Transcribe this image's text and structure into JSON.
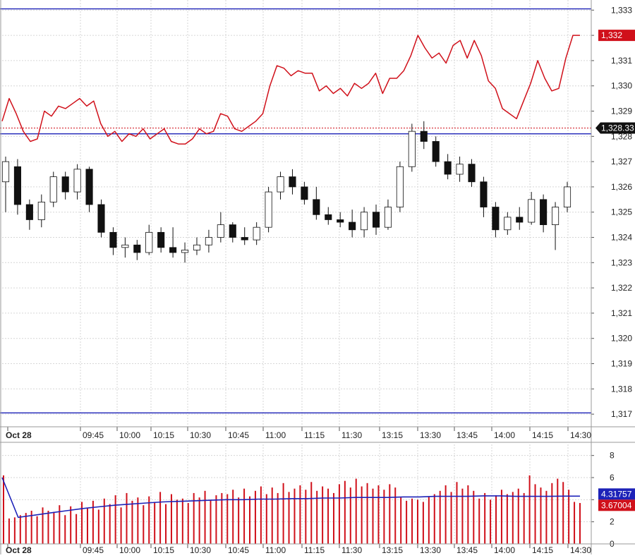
{
  "colors": {
    "background": "#ffffff",
    "grid": "#d6d6d6",
    "price_line": "#d0101a",
    "candle": "#111111",
    "blue_line": "#1d22b8",
    "volume_bar": "#d0101a",
    "avg_line": "#1d22b8",
    "price_badge": "#d0101a",
    "last_badge": "#111111",
    "avg_badge": "#1d22b8"
  },
  "chart_data": [
    {
      "type": "line",
      "panel": "price",
      "title": "",
      "ylim": [
        1.3165,
        1.3334
      ],
      "y_ticks": [
        {
          "value": 1.333,
          "label": "1,333"
        },
        {
          "value": 1.332,
          "label": "1,332"
        },
        {
          "value": 1.331,
          "label": "1,331"
        },
        {
          "value": 1.33,
          "label": "1,330"
        },
        {
          "value": 1.329,
          "label": "1,329"
        },
        {
          "value": 1.328,
          "label": "1,328"
        },
        {
          "value": 1.327,
          "label": "1,327"
        },
        {
          "value": 1.326,
          "label": "1,326"
        },
        {
          "value": 1.325,
          "label": "1,325"
        },
        {
          "value": 1.324,
          "label": "1,324"
        },
        {
          "value": 1.323,
          "label": "1,323"
        },
        {
          "value": 1.322,
          "label": "1,322"
        },
        {
          "value": 1.321,
          "label": "1,321"
        },
        {
          "value": 1.32,
          "label": "1,320"
        },
        {
          "value": 1.319,
          "label": "1,319"
        },
        {
          "value": 1.318,
          "label": "1,318"
        },
        {
          "value": 1.317,
          "label": "1,317"
        }
      ],
      "x_labels": [
        "Oct 28",
        "09:45",
        "10:00",
        "10:15",
        "10:30",
        "10:45",
        "11:00",
        "11:15",
        "11:30",
        "13:15",
        "13:30",
        "13:45",
        "14:00",
        "14:15",
        "14:30"
      ],
      "horizontal_lines": [
        1.33305,
        1.3281,
        1.31705
      ],
      "red_line": {
        "last_label": "1,332",
        "values": [
          1.3286,
          1.3295,
          1.3289,
          1.3282,
          1.3278,
          1.3279,
          1.329,
          1.3288,
          1.3292,
          1.3291,
          1.3293,
          1.3295,
          1.3292,
          1.3294,
          1.3285,
          1.328,
          1.3282,
          1.3278,
          1.3281,
          1.328,
          1.3283,
          1.3279,
          1.3281,
          1.3283,
          1.3278,
          1.3277,
          1.3277,
          1.3279,
          1.3283,
          1.3281,
          1.3282,
          1.3289,
          1.3288,
          1.3283,
          1.3282,
          1.3284,
          1.3286,
          1.3289,
          1.33,
          1.3308,
          1.3307,
          1.3304,
          1.3306,
          1.3305,
          1.3305,
          1.3298,
          1.33,
          1.3297,
          1.3299,
          1.3296,
          1.3301,
          1.3299,
          1.3301,
          1.3305,
          1.3297,
          1.3303,
          1.3303,
          1.3306,
          1.3312,
          1.332,
          1.3315,
          1.3311,
          1.3313,
          1.3309,
          1.3316,
          1.3318,
          1.3311,
          1.3318,
          1.3312,
          1.3302,
          1.3299,
          1.3291,
          1.3289,
          1.3287,
          1.3294,
          1.3301,
          1.331,
          1.3303,
          1.3298,
          1.3299,
          1.3311,
          1.332,
          1.332
        ]
      },
      "candles": {
        "last_label": "1,328.33",
        "reference_value": 1.32833,
        "series": [
          {
            "x": 0,
            "o": 1.3262,
            "h": 1.3272,
            "l": 1.325,
            "c": 1.327
          },
          {
            "x": 1,
            "o": 1.3268,
            "h": 1.3271,
            "l": 1.3249,
            "c": 1.3253
          },
          {
            "x": 2,
            "o": 1.3253,
            "h": 1.3255,
            "l": 1.3243,
            "c": 1.3247
          },
          {
            "x": 3,
            "o": 1.3247,
            "h": 1.3257,
            "l": 1.3244,
            "c": 1.3254
          },
          {
            "x": 4,
            "o": 1.3254,
            "h": 1.3266,
            "l": 1.3252,
            "c": 1.3264
          },
          {
            "x": 5,
            "o": 1.3264,
            "h": 1.3266,
            "l": 1.3255,
            "c": 1.3258
          },
          {
            "x": 6,
            "o": 1.3258,
            "h": 1.3269,
            "l": 1.3255,
            "c": 1.3267
          },
          {
            "x": 7,
            "o": 1.3267,
            "h": 1.3268,
            "l": 1.325,
            "c": 1.3253
          },
          {
            "x": 8,
            "o": 1.3253,
            "h": 1.3255,
            "l": 1.324,
            "c": 1.3242
          },
          {
            "x": 9,
            "o": 1.3242,
            "h": 1.3244,
            "l": 1.3233,
            "c": 1.3236
          },
          {
            "x": 10,
            "o": 1.3236,
            "h": 1.324,
            "l": 1.3232,
            "c": 1.3237
          },
          {
            "x": 11,
            "o": 1.3237,
            "h": 1.3239,
            "l": 1.3231,
            "c": 1.3234
          },
          {
            "x": 12,
            "o": 1.3234,
            "h": 1.3245,
            "l": 1.3233,
            "c": 1.3242
          },
          {
            "x": 13,
            "o": 1.3242,
            "h": 1.3244,
            "l": 1.3234,
            "c": 1.3236
          },
          {
            "x": 14,
            "o": 1.3236,
            "h": 1.3244,
            "l": 1.3232,
            "c": 1.3234
          },
          {
            "x": 15,
            "o": 1.3234,
            "h": 1.3238,
            "l": 1.323,
            "c": 1.3235
          },
          {
            "x": 16,
            "o": 1.3235,
            "h": 1.324,
            "l": 1.3233,
            "c": 1.3237
          },
          {
            "x": 17,
            "o": 1.3237,
            "h": 1.3243,
            "l": 1.3234,
            "c": 1.324
          },
          {
            "x": 18,
            "o": 1.324,
            "h": 1.325,
            "l": 1.3238,
            "c": 1.3245
          },
          {
            "x": 19,
            "o": 1.3245,
            "h": 1.3246,
            "l": 1.3238,
            "c": 1.324
          },
          {
            "x": 20,
            "o": 1.324,
            "h": 1.3244,
            "l": 1.3237,
            "c": 1.3239
          },
          {
            "x": 21,
            "o": 1.3239,
            "h": 1.3246,
            "l": 1.3237,
            "c": 1.3244
          },
          {
            "x": 22,
            "o": 1.3244,
            "h": 1.326,
            "l": 1.3242,
            "c": 1.3258
          },
          {
            "x": 23,
            "o": 1.3258,
            "h": 1.3266,
            "l": 1.3255,
            "c": 1.3264
          },
          {
            "x": 24,
            "o": 1.3264,
            "h": 1.3267,
            "l": 1.3257,
            "c": 1.326
          },
          {
            "x": 25,
            "o": 1.326,
            "h": 1.3262,
            "l": 1.3253,
            "c": 1.3255
          },
          {
            "x": 26,
            "o": 1.3255,
            "h": 1.326,
            "l": 1.3247,
            "c": 1.3249
          },
          {
            "x": 27,
            "o": 1.3249,
            "h": 1.3252,
            "l": 1.3245,
            "c": 1.3247
          },
          {
            "x": 28,
            "o": 1.3247,
            "h": 1.325,
            "l": 1.3244,
            "c": 1.3246
          },
          {
            "x": 29,
            "o": 1.3246,
            "h": 1.3251,
            "l": 1.324,
            "c": 1.3243
          },
          {
            "x": 30,
            "o": 1.3243,
            "h": 1.3252,
            "l": 1.324,
            "c": 1.325
          },
          {
            "x": 31,
            "o": 1.325,
            "h": 1.3253,
            "l": 1.3241,
            "c": 1.3244
          },
          {
            "x": 32,
            "o": 1.3244,
            "h": 1.3255,
            "l": 1.3243,
            "c": 1.3252
          },
          {
            "x": 33,
            "o": 1.3252,
            "h": 1.327,
            "l": 1.325,
            "c": 1.3268
          },
          {
            "x": 34,
            "o": 1.3268,
            "h": 1.3285,
            "l": 1.3266,
            "c": 1.3282
          },
          {
            "x": 35,
            "o": 1.3282,
            "h": 1.3286,
            "l": 1.3275,
            "c": 1.3278
          },
          {
            "x": 36,
            "o": 1.3278,
            "h": 1.328,
            "l": 1.3268,
            "c": 1.327
          },
          {
            "x": 37,
            "o": 1.327,
            "h": 1.3273,
            "l": 1.3263,
            "c": 1.3265
          },
          {
            "x": 38,
            "o": 1.3265,
            "h": 1.3272,
            "l": 1.3262,
            "c": 1.3269
          },
          {
            "x": 39,
            "o": 1.3269,
            "h": 1.3271,
            "l": 1.326,
            "c": 1.3262
          },
          {
            "x": 40,
            "o": 1.3262,
            "h": 1.3264,
            "l": 1.3248,
            "c": 1.3252
          },
          {
            "x": 41,
            "o": 1.3252,
            "h": 1.3254,
            "l": 1.324,
            "c": 1.3243
          },
          {
            "x": 42,
            "o": 1.3243,
            "h": 1.325,
            "l": 1.3241,
            "c": 1.3248
          },
          {
            "x": 43,
            "o": 1.3248,
            "h": 1.3252,
            "l": 1.3243,
            "c": 1.3246
          },
          {
            "x": 44,
            "o": 1.3246,
            "h": 1.3258,
            "l": 1.3245,
            "c": 1.3255
          },
          {
            "x": 45,
            "o": 1.3255,
            "h": 1.3257,
            "l": 1.3242,
            "c": 1.3245
          },
          {
            "x": 46,
            "o": 1.3245,
            "h": 1.3254,
            "l": 1.3235,
            "c": 1.3252
          },
          {
            "x": 47,
            "o": 1.3252,
            "h": 1.3262,
            "l": 1.325,
            "c": 1.326
          }
        ]
      }
    },
    {
      "type": "bar",
      "panel": "volume",
      "ylim": [
        0,
        9
      ],
      "y_ticks": [
        {
          "value": 8,
          "label": "8"
        },
        {
          "value": 6,
          "label": "6"
        },
        {
          "value": 4,
          "label": "4"
        },
        {
          "value": 2,
          "label": "2"
        },
        {
          "value": 0,
          "label": "0"
        }
      ],
      "x_labels": [
        "Oct 28",
        "09:45",
        "10:00",
        "10:15",
        "10:30",
        "10:45",
        "11:00",
        "11:15",
        "11:30",
        "13:15",
        "13:30",
        "13:45",
        "14:00",
        "14:15",
        "14:30"
      ],
      "avg_label": "4.31757",
      "last_label": "3.67004",
      "values": [
        6.2,
        2.3,
        2.4,
        2.6,
        2.8,
        3.0,
        2.5,
        3.3,
        3.0,
        2.9,
        3.5,
        2.6,
        3.4,
        2.7,
        3.8,
        3.2,
        3.9,
        3.1,
        4.1,
        3.6,
        4.4,
        3.3,
        4.6,
        3.9,
        4.2,
        3.5,
        4.3,
        3.8,
        4.7,
        3.6,
        4.5,
        4.0,
        4.1,
        3.7,
        4.6,
        4.2,
        4.8,
        4.0,
        4.4,
        4.6,
        4.5,
        4.9,
        4.2,
        5.0,
        4.3,
        4.8,
        5.2,
        4.5,
        5.1,
        4.6,
        5.5,
        4.7,
        5.0,
        5.3,
        4.9,
        5.6,
        4.8,
        5.2,
        5.0,
        4.6,
        5.4,
        5.7,
        5.1,
        5.9,
        5.2,
        5.5,
        5.0,
        5.3,
        4.9,
        5.4,
        5.1,
        4.2,
        3.9,
        4.1,
        4.0,
        3.8,
        4.3,
        4.5,
        4.8,
        5.3,
        4.7,
        5.6,
        5.0,
        5.3,
        4.8,
        4.1,
        4.6,
        4.0,
        4.4,
        4.9,
        4.5,
        4.7,
        5.0,
        4.6,
        6.2,
        5.4,
        5.1,
        4.8,
        5.5,
        5.9,
        5.6,
        4.9,
        3.8,
        3.7
      ],
      "avg_values": [
        6.0,
        2.4,
        2.6,
        2.8,
        3.0,
        3.2,
        3.35,
        3.5,
        3.6,
        3.7,
        3.8,
        3.85,
        3.9,
        3.95,
        4.0,
        4.0,
        4.05,
        4.05,
        4.1,
        4.1,
        4.15,
        4.15,
        4.2,
        4.2,
        4.2,
        4.25,
        4.25,
        4.3,
        4.3,
        4.3,
        4.35,
        4.35,
        4.3,
        4.3,
        4.3,
        4.32,
        4.32
      ]
    }
  ]
}
